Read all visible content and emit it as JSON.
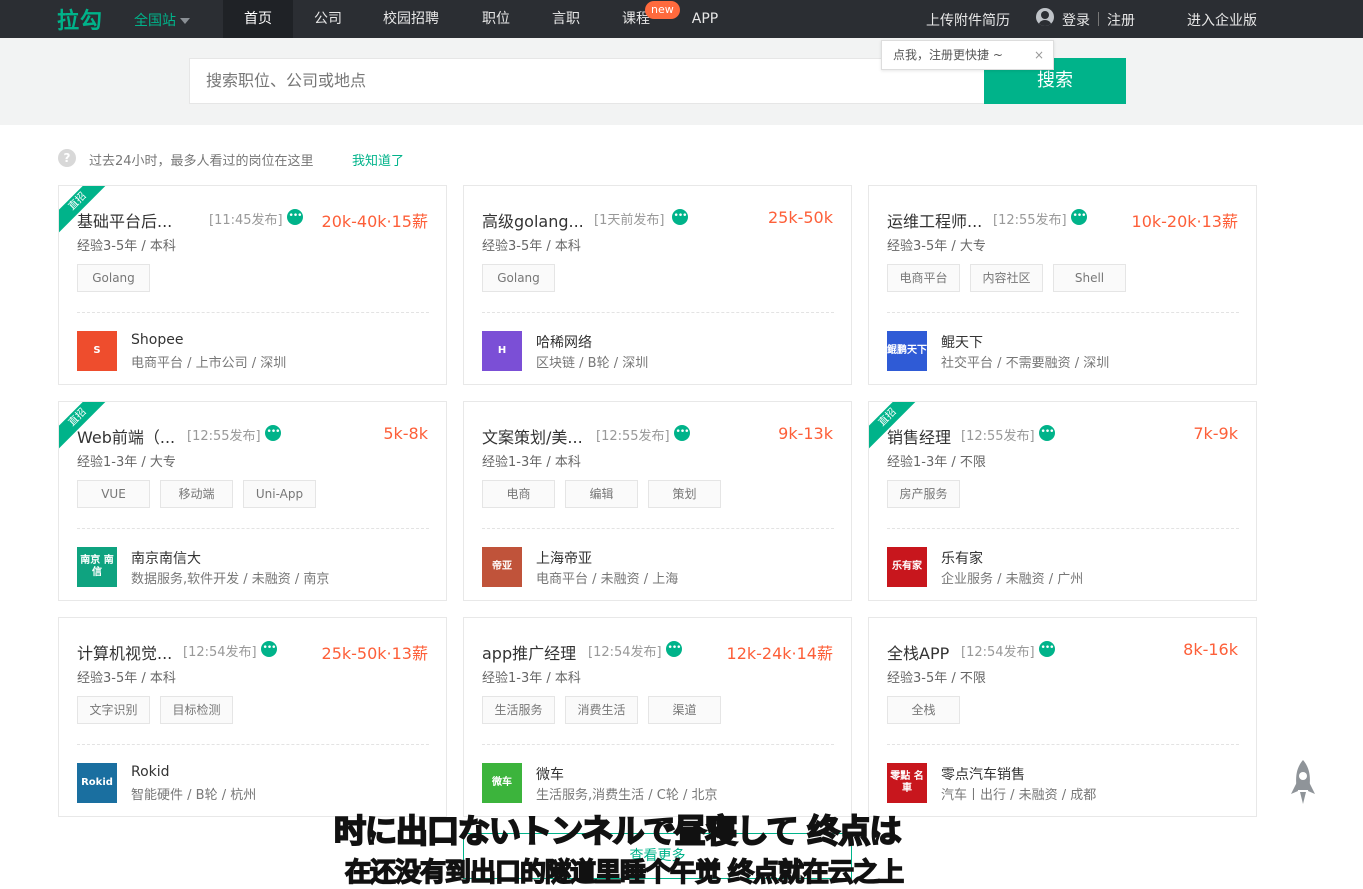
{
  "header": {
    "logo": "拉勾",
    "site_selector": "全国站",
    "nav": [
      "首页",
      "公司",
      "校园招聘",
      "职位",
      "言职",
      "课程",
      "APP"
    ],
    "new_badge": "new",
    "upload_resume": "上传附件简历",
    "login": "登录",
    "register": "注册",
    "enterprise": "进入企业版"
  },
  "tooltip": {
    "text": "点我，注册更快捷 ~",
    "close": "×"
  },
  "search": {
    "placeholder": "搜索职位、公司或地点",
    "button": "搜索"
  },
  "hint": {
    "icon": "?",
    "text": "过去24小时，最多人看过的岗位在这里",
    "link": "我知道了"
  },
  "jobs": [
    {
      "ribbon": "直招",
      "title": "基础平台后...",
      "time": "[11:45发布]",
      "salary": "20k-40k·15薪",
      "req": "经验3-5年 / 本科",
      "tags": [
        "Golang"
      ],
      "company": "Shopee",
      "info": "电商平台 / 上市公司 / 深圳",
      "logo_text": "S",
      "logo_color": "#ee4d2d"
    },
    {
      "ribbon": "",
      "title": "高级golang...",
      "time": "[1天前发布]",
      "salary": "25k-50k",
      "req": "经验3-5年 / 本科",
      "tags": [
        "Golang"
      ],
      "company": "哈稀网络",
      "info": "区块链 / B轮 / 深圳",
      "logo_text": "H",
      "logo_color": "#7b4fd6"
    },
    {
      "ribbon": "",
      "title": "运维工程师...",
      "time": "[12:55发布]",
      "salary": "10k-20k·13薪",
      "req": "经验3-5年 / 大专",
      "tags": [
        "电商平台",
        "内容社区",
        "Shell"
      ],
      "company": "鲲天下",
      "info": "社交平台 / 不需要融资 / 深圳",
      "logo_text": "鲲鹏天下",
      "logo_color": "#2f5bd6"
    },
    {
      "ribbon": "直招",
      "title": "Web前端（...",
      "time": "[12:55发布]",
      "salary": "5k-8k",
      "req": "经验1-3年 / 大专",
      "tags": [
        "VUE",
        "移动端",
        "Uni-App"
      ],
      "company": "南京南信大",
      "info": "数据服务,软件开发 / 未融资 / 南京",
      "logo_text": "南京 南信",
      "logo_color": "#0fa380"
    },
    {
      "ribbon": "",
      "title": "文案策划/美...",
      "time": "[12:55发布]",
      "salary": "9k-13k",
      "req": "经验1-3年 / 本科",
      "tags": [
        "电商",
        "编辑",
        "策划"
      ],
      "company": "上海帝亚",
      "info": "电商平台 / 未融资 / 上海",
      "logo_text": "帝亚",
      "logo_color": "#c0533a"
    },
    {
      "ribbon": "直招",
      "title": "销售经理",
      "time": "[12:55发布]",
      "salary": "7k-9k",
      "req": "经验1-3年 / 不限",
      "tags": [
        "房产服务"
      ],
      "company": "乐有家",
      "info": "企业服务 / 未融资 / 广州",
      "logo_text": "乐有家",
      "logo_color": "#c8161d"
    },
    {
      "ribbon": "",
      "title": "计算机视觉...",
      "time": "[12:54发布]",
      "salary": "25k-50k·13薪",
      "req": "经验3-5年 / 本科",
      "tags": [
        "文字识别",
        "目标检测"
      ],
      "company": "Rokid",
      "info": "智能硬件 / B轮 / 杭州",
      "logo_text": "Rokid",
      "logo_color": "#1a6fa0"
    },
    {
      "ribbon": "",
      "title": "app推广经理",
      "time": "[12:54发布]",
      "salary": "12k-24k·14薪",
      "req": "经验1-3年 / 本科",
      "tags": [
        "生活服务",
        "消费生活",
        "渠道"
      ],
      "company": "微车",
      "info": "生活服务,消费生活 / C轮 / 北京",
      "logo_text": "微车",
      "logo_color": "#3cb43c"
    },
    {
      "ribbon": "",
      "title": "全栈APP",
      "time": "[12:54发布]",
      "salary": "8k-16k",
      "req": "经验3-5年 / 不限",
      "tags": [
        "全栈"
      ],
      "company": "零点汽车销售",
      "info": "汽车丨出行 / 未融资 / 成都",
      "logo_text": "零點 名車",
      "logo_color": "#c8161d"
    }
  ],
  "more_button": "查看更多",
  "subtitles": {
    "line1": "时に出口ないトンネルで昼寝して 终点は",
    "line2": "在还没有到出口的隧道里睡个午觉 终点就在云之上"
  }
}
